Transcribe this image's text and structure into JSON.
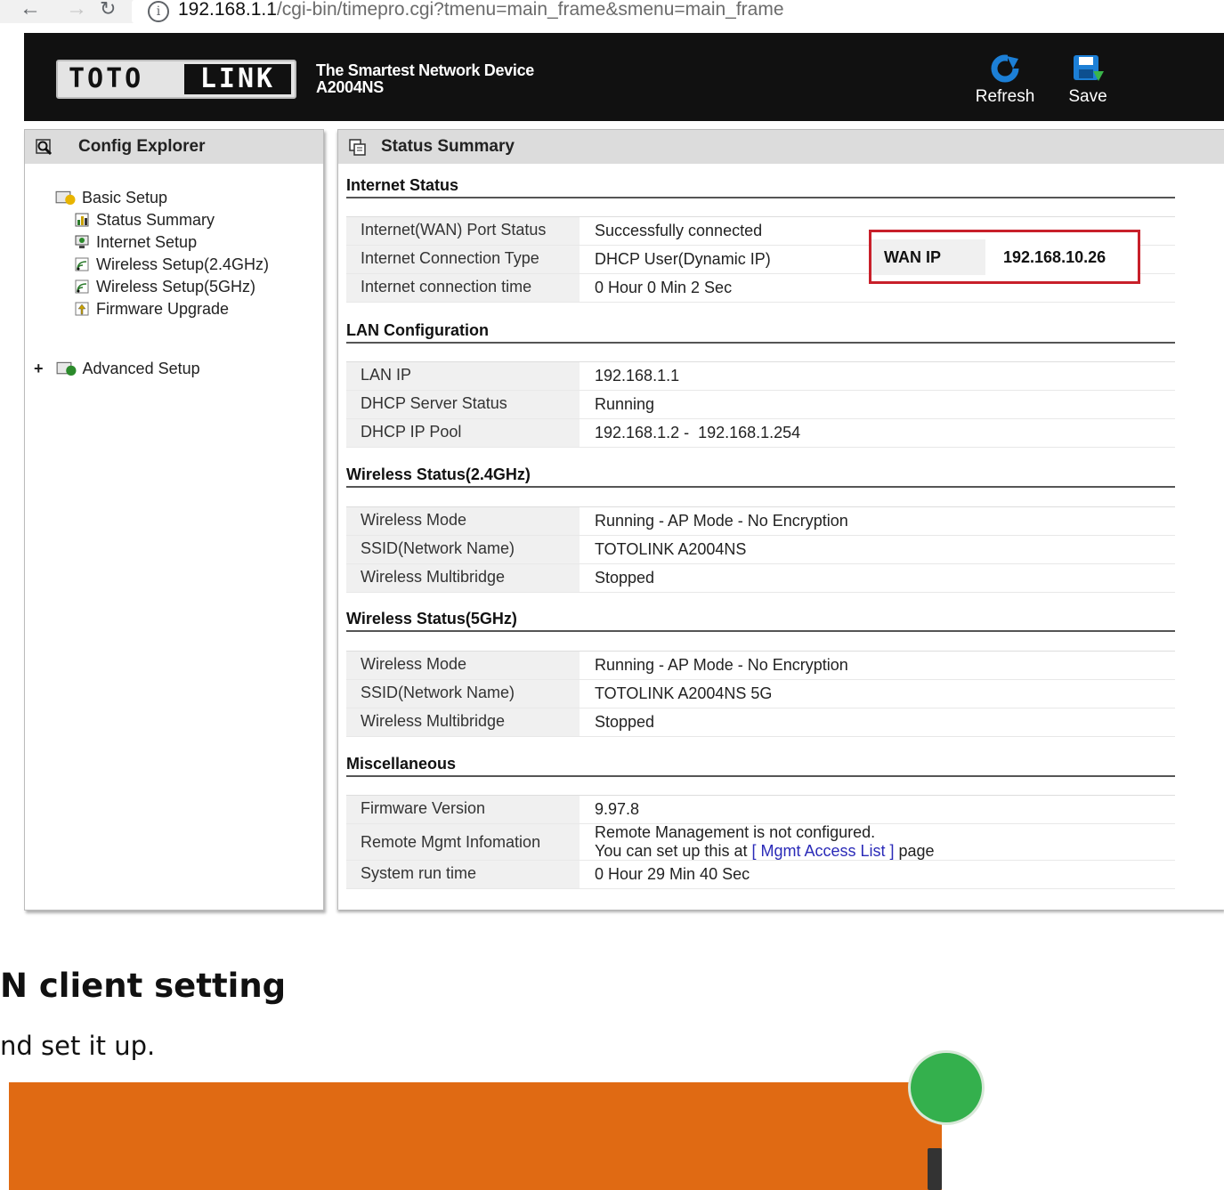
{
  "browser": {
    "url_host": "192.168.1.1",
    "url_path": "/cgi-bin/timepro.cgi?tmenu=main_frame&smenu=main_frame",
    "info_glyph": "i"
  },
  "header": {
    "logo_left": "TOTO",
    "logo_right": "LINK",
    "tagline": "The Smartest Network Device",
    "model": "A2004NS",
    "refresh_label": "Refresh",
    "save_label": "Save",
    "colors": {
      "refresh": "#1c7fd6",
      "save": "#1c7fd6",
      "save_arrow": "#3ab54a"
    }
  },
  "sidebar": {
    "title": "Config Explorer",
    "basic_setup": "Basic Setup",
    "items": [
      {
        "label": "Status Summary",
        "icon": "chart-icon"
      },
      {
        "label": "Internet Setup",
        "icon": "monitor-icon"
      },
      {
        "label": "Wireless Setup(2.4GHz)",
        "icon": "wireless-icon"
      },
      {
        "label": "Wireless Setup(5GHz)",
        "icon": "wireless-icon"
      },
      {
        "label": "Firmware Upgrade",
        "icon": "upgrade-icon"
      }
    ],
    "advanced_setup": "Advanced Setup",
    "expand_glyph": "+"
  },
  "main": {
    "title": "Status Summary",
    "sections": [
      {
        "heading": "Internet Status",
        "rows": [
          {
            "label": "Internet(WAN) Port Status",
            "value": "Successfully connected"
          },
          {
            "label": "Internet Connection Type",
            "value": "DHCP User(Dynamic IP)"
          },
          {
            "label": "Internet connection time",
            "value": "0 Hour 0 Min 2 Sec"
          }
        ]
      },
      {
        "heading": "LAN Configuration",
        "rows": [
          {
            "label": "LAN IP",
            "value": "192.168.1.1"
          },
          {
            "label": "DHCP Server Status",
            "value": "Running"
          },
          {
            "label": "DHCP IP Pool",
            "value": "192.168.1.2 -  192.168.1.254"
          }
        ]
      },
      {
        "heading": "Wireless Status(2.4GHz)",
        "rows": [
          {
            "label": "Wireless Mode",
            "value": "Running - AP Mode - No Encryption"
          },
          {
            "label": "SSID(Network Name)",
            "value": "TOTOLINK A2004NS"
          },
          {
            "label": "Wireless Multibridge",
            "value": "Stopped"
          }
        ]
      },
      {
        "heading": "Wireless Status(5GHz)",
        "rows": [
          {
            "label": "Wireless Mode",
            "value": "Running - AP Mode - No Encryption"
          },
          {
            "label": "SSID(Network Name)",
            "value": "TOTOLINK A2004NS 5G"
          },
          {
            "label": "Wireless Multibridge",
            "value": "Stopped"
          }
        ]
      },
      {
        "heading": "Miscellaneous",
        "rows": [
          {
            "label": "Firmware Version",
            "value": "9.97.8"
          },
          {
            "label": "Remote Mgmt Infomation",
            "value_line1": "Remote Management is not configured.",
            "value_line2_pre": "You can set up this at ",
            "value_link": "[ Mgmt Access List ]",
            "value_line2_post": " page"
          },
          {
            "label": "System run time",
            "value": "0 Hour 29 Min 40 Sec"
          }
        ]
      }
    ],
    "wan_ip": {
      "label": "WAN IP",
      "value": "192.168.10.26",
      "highlight_color": "#c8202a"
    }
  },
  "document": {
    "heading_fragment": "N client setting",
    "text_fragment": "nd set it up.",
    "banner_color": "#e06a13"
  }
}
